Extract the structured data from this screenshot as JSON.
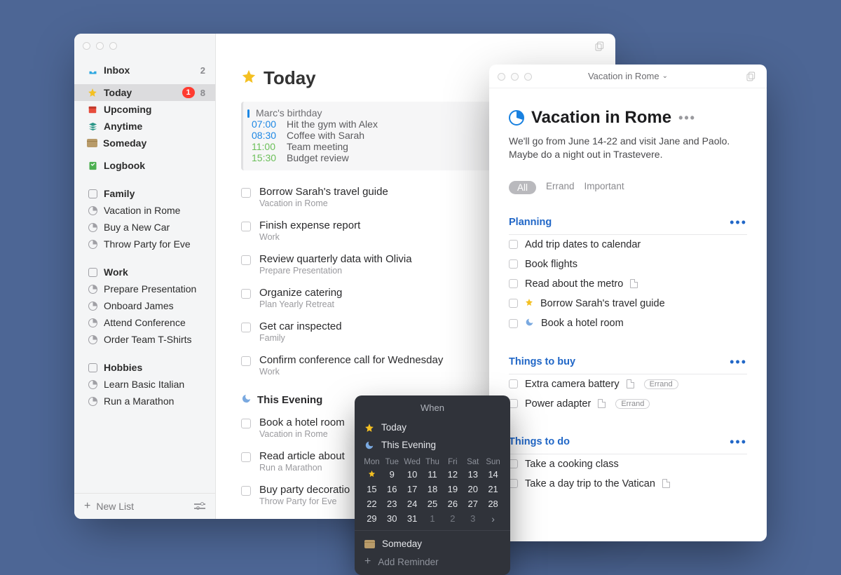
{
  "sidebar": {
    "inbox": {
      "label": "Inbox",
      "count": "2"
    },
    "today": {
      "label": "Today",
      "badge": "1",
      "count": "8"
    },
    "upcoming": {
      "label": "Upcoming"
    },
    "anytime": {
      "label": "Anytime"
    },
    "someday": {
      "label": "Someday"
    },
    "logbook": {
      "label": "Logbook"
    },
    "areas": [
      {
        "name": "Family",
        "projects": [
          "Vacation in Rome",
          "Buy a New Car",
          "Throw Party for Eve"
        ]
      },
      {
        "name": "Work",
        "projects": [
          "Prepare Presentation",
          "Onboard James",
          "Attend Conference",
          "Order Team T-Shirts"
        ]
      },
      {
        "name": "Hobbies",
        "projects": [
          "Learn Basic Italian",
          "Run a Marathon"
        ]
      }
    ],
    "new_list": "New List"
  },
  "today": {
    "title": "Today",
    "events": {
      "birthday": "Marc's birthday",
      "items": [
        {
          "time": "07:00",
          "label": "Hit the gym with Alex"
        },
        {
          "time": "08:30",
          "label": "Coffee with Sarah"
        },
        {
          "time": "11:00",
          "label": "Team meeting",
          "green": true
        },
        {
          "time": "15:30",
          "label": "Budget review",
          "green": true
        }
      ]
    },
    "tasks": [
      {
        "title": "Borrow Sarah's travel guide",
        "sub": "Vacation in Rome"
      },
      {
        "title": "Finish expense report",
        "sub": "Work"
      },
      {
        "title": "Review quarterly data with Olivia",
        "sub": "Prepare Presentation"
      },
      {
        "title": "Organize catering",
        "sub": "Plan Yearly Retreat"
      },
      {
        "title": "Get car inspected",
        "sub": "Family"
      },
      {
        "title": "Confirm conference call for Wednesday",
        "sub": "Work"
      }
    ],
    "evening_header": "This Evening",
    "evening": [
      {
        "title": "Book a hotel room",
        "sub": "Vacation in Rome"
      },
      {
        "title": "Read article about",
        "sub": "Run a Marathon"
      },
      {
        "title": "Buy party decoratio",
        "sub": "Throw Party for Eve"
      }
    ]
  },
  "project": {
    "titlebar": "Vacation in Rome",
    "title": "Vacation in Rome",
    "desc": "We'll go from June 14-22 and visit Jane and Paolo. Maybe do a night out in Trastevere.",
    "tags": {
      "all": "All",
      "t1": "Errand",
      "t2": "Important"
    },
    "groups": [
      {
        "title": "Planning",
        "tasks": [
          {
            "title": "Add trip dates to calendar"
          },
          {
            "title": "Book flights"
          },
          {
            "title": "Read about the metro",
            "doc": true
          },
          {
            "title": "Borrow Sarah's travel guide",
            "star": true
          },
          {
            "title": "Book a hotel room",
            "moon": true
          }
        ]
      },
      {
        "title": "Things to buy",
        "tasks": [
          {
            "title": "Extra camera battery",
            "doc": true,
            "tag": "Errand"
          },
          {
            "title": "Power adapter",
            "doc": true,
            "tag": "Errand"
          }
        ]
      },
      {
        "title": "Things to do",
        "tasks": [
          {
            "title": "Take a cooking class"
          },
          {
            "title": "Take a day trip to the Vatican",
            "doc": true
          }
        ]
      }
    ]
  },
  "popover": {
    "title": "When",
    "today": "Today",
    "evening": "This Evening",
    "dow": [
      "Mon",
      "Tue",
      "Wed",
      "Thu",
      "Fri",
      "Sat",
      "Sun"
    ],
    "rows": [
      [
        "★",
        "9",
        "10",
        "11",
        "12",
        "13",
        "14"
      ],
      [
        "15",
        "16",
        "17",
        "18",
        "19",
        "20",
        "21"
      ],
      [
        "22",
        "23",
        "24",
        "25",
        "26",
        "27",
        "28"
      ],
      [
        "29",
        "30",
        "31",
        "1",
        "2",
        "3",
        "›"
      ]
    ],
    "someday": "Someday",
    "reminder": "Add Reminder"
  }
}
